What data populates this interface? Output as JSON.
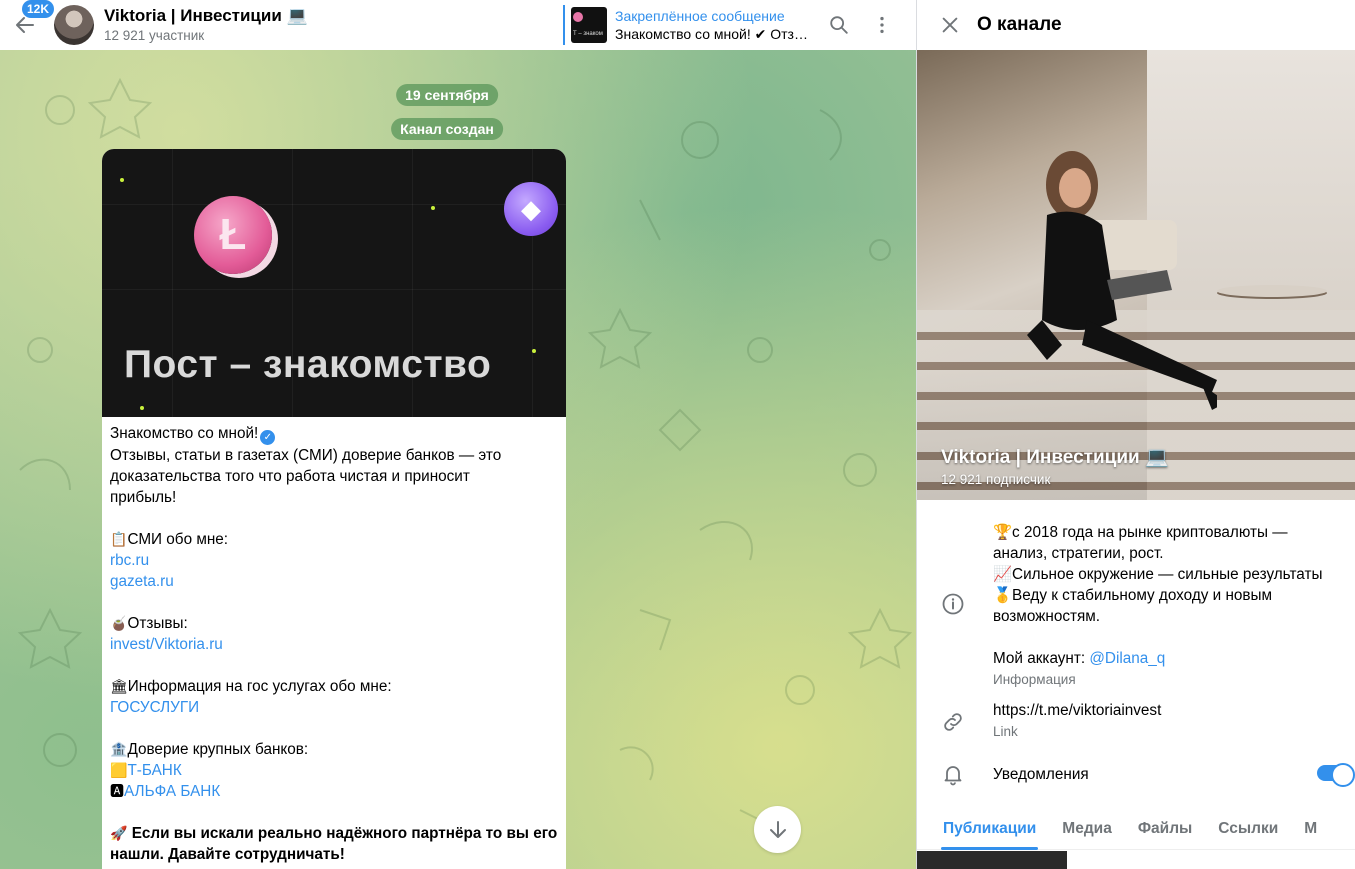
{
  "header": {
    "unread_count": "12K",
    "title": "Viktoria | Инвестиции 💻",
    "subtitle": "12 921 участник",
    "pinned_label": "Закреплённое сообщение",
    "pinned_text": "Знакомство со мной! ✔ Отзывы",
    "pinned_thumb_text": "Т – знаком"
  },
  "chat": {
    "date": "19 сентября",
    "service": "Канал создан",
    "post": {
      "image_title": "Пост – знакомство",
      "lines": [
        "Знакомство со мной!",
        "Отзывы, статьи в газетах (СМИ) доверие банков — это",
        "доказательства того что работа чистая и приносит",
        "прибыль!",
        "",
        "СМИ обо мне:",
        "rbc.ru",
        "gazeta.ru",
        "",
        "Отзывы:",
        "invest/Viktoria.ru",
        "",
        "Информация на гос услугах обо мне:",
        "ГОСУСЛУГИ",
        "",
        "Доверие крупных банков:",
        "Т-БАНК",
        "АЛЬФА БАНК",
        "",
        "Если вы искали реально надёжного партнёра то вы его",
        "нашли. Давайте сотрудничать!"
      ]
    }
  },
  "info": {
    "panel_title": "О канале",
    "name": "Viktoria | Инвестиции 💻",
    "subscribers": "12 921 подписчик",
    "about_lines": [
      "🏆с 2018 года на рынке криптовалюты —",
      "анализ, стратегии, рост.",
      "📈Сильное окружение — сильные результаты",
      "🥇Веду к стабильному доходу и новым",
      "возможностям.",
      "",
      "Мой аккаунт: "
    ],
    "account_handle": "@Dilana_q",
    "about_caption": "Информация",
    "link": "https://t.me/viktoriainvest",
    "link_caption": "Link",
    "notifications_label": "Уведомления",
    "notifications_on": true,
    "tabs": [
      "Публикации",
      "Медиа",
      "Файлы",
      "Ссылки",
      "М"
    ]
  },
  "colors": {
    "accent": "#3390ec",
    "date_pill": "#5a965a"
  }
}
